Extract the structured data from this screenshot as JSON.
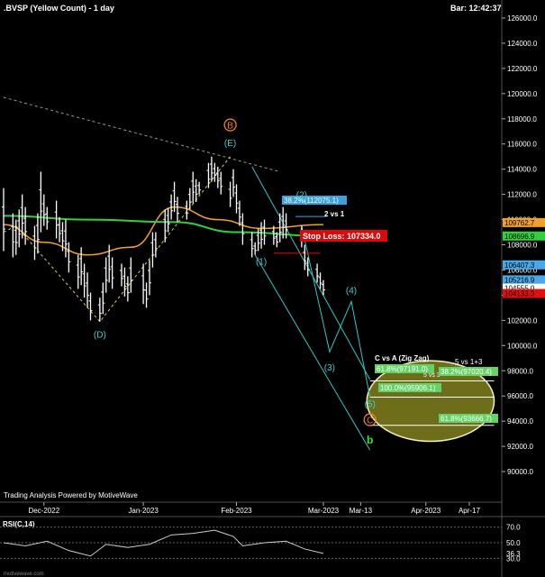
{
  "header": {
    "symbol_title": ".BVSP (Yellow Count) - 1 day",
    "bar_time": "Bar: 12:42:37"
  },
  "footer": {
    "credit": "Trading Analysis Powered by MotiveWave",
    "site": "motivewave.com"
  },
  "colors": {
    "background": "#000000",
    "price_bars": "#ffffff",
    "ma_orange": "#f0a030",
    "ma_green": "#30d040",
    "channel_cyan": "#30c8c8",
    "wave_yellow": "#e0d040",
    "target_fill": "#6e6e1a",
    "stop_red": "#e01010",
    "label_orange": "#f08020",
    "label_green": "#40e040"
  },
  "chart_data": {
    "type": "ohlc",
    "title": ".BVSP (Yellow Count) - 1 day",
    "ylim": [
      88000,
      127000
    ],
    "y_ticks": [
      90000,
      92000,
      94000,
      96000,
      98000,
      100000,
      102000,
      104000,
      106000,
      108000,
      110000,
      112000,
      114000,
      116000,
      118000,
      120000,
      122000,
      124000,
      126000
    ],
    "y_tick_labels": [
      "90000.0",
      "92000.0",
      "94000.0",
      "96000.0",
      "98000.0",
      "100000.0",
      "102000.0",
      "104000.0",
      "106000.0",
      "108000.0",
      "110000.0",
      "112000.0",
      "114000.0",
      "116000.0",
      "118000.0",
      "120000.0",
      "122000.0",
      "124000.0",
      "126000.0"
    ],
    "x_labels": [
      {
        "date": "2022-12-01",
        "label": "Dec-2022"
      },
      {
        "date": "2023-01-02",
        "label": "Jan-2023"
      },
      {
        "date": "2023-02-01",
        "label": "Feb-2023"
      },
      {
        "date": "2023-03-01",
        "label": "Mar-2023"
      },
      {
        "date": "2023-03-13",
        "label": "Mar-13"
      },
      {
        "date": "2023-04-03",
        "label": "Apr-2023"
      },
      {
        "date": "2023-04-17",
        "label": "Apr-17"
      }
    ],
    "x_range": [
      "2022-11-18",
      "2023-04-26"
    ],
    "price_bars": [
      {
        "date": "2022-11-18",
        "high": 112500,
        "low": 107500
      },
      {
        "date": "2022-11-21",
        "high": 110500,
        "low": 107000
      },
      {
        "date": "2022-11-22",
        "high": 110000,
        "low": 107200
      },
      {
        "date": "2022-11-23",
        "high": 110800,
        "low": 107800
      },
      {
        "date": "2022-11-24",
        "high": 112000,
        "low": 108500
      },
      {
        "date": "2022-11-25",
        "high": 111000,
        "low": 108000
      },
      {
        "date": "2022-11-28",
        "high": 109500,
        "low": 106800
      },
      {
        "date": "2022-11-29",
        "high": 110500,
        "low": 107300
      },
      {
        "date": "2022-11-30",
        "high": 113800,
        "low": 109000
      },
      {
        "date": "2022-12-01",
        "high": 112000,
        "low": 109500
      },
      {
        "date": "2022-12-02",
        "high": 111000,
        "low": 109200
      },
      {
        "date": "2022-12-05",
        "high": 111500,
        "low": 108500
      },
      {
        "date": "2022-12-06",
        "high": 110200,
        "low": 108200
      },
      {
        "date": "2022-12-07",
        "high": 109800,
        "low": 107500
      },
      {
        "date": "2022-12-08",
        "high": 110000,
        "low": 107000
      },
      {
        "date": "2022-12-09",
        "high": 108200,
        "low": 105800
      },
      {
        "date": "2022-12-12",
        "high": 107200,
        "low": 104500
      },
      {
        "date": "2022-12-13",
        "high": 107800,
        "low": 104800
      },
      {
        "date": "2022-12-14",
        "high": 106500,
        "low": 103800
      },
      {
        "date": "2022-12-15",
        "high": 105800,
        "low": 103000
      },
      {
        "date": "2022-12-16",
        "high": 104200,
        "low": 102000
      },
      {
        "date": "2022-12-19",
        "high": 103800,
        "low": 101900
      },
      {
        "date": "2022-12-20",
        "high": 105000,
        "low": 102500
      },
      {
        "date": "2022-12-21",
        "high": 107000,
        "low": 104200
      },
      {
        "date": "2022-12-22",
        "high": 108000,
        "low": 105000
      },
      {
        "date": "2022-12-23",
        "high": 107000,
        "low": 104500
      },
      {
        "date": "2022-12-26",
        "high": 106500,
        "low": 104700
      },
      {
        "date": "2022-12-27",
        "high": 106200,
        "low": 103900
      },
      {
        "date": "2022-12-28",
        "high": 105500,
        "low": 103500
      },
      {
        "date": "2022-12-29",
        "high": 107000,
        "low": 104200
      },
      {
        "date": "2023-01-02",
        "high": 106500,
        "low": 103300
      },
      {
        "date": "2023-01-03",
        "high": 105000,
        "low": 103000
      },
      {
        "date": "2023-01-04",
        "high": 106800,
        "low": 104000
      },
      {
        "date": "2023-01-05",
        "high": 109000,
        "low": 106200
      },
      {
        "date": "2023-01-06",
        "high": 109000,
        "low": 107000
      },
      {
        "date": "2023-01-09",
        "high": 110800,
        "low": 108200
      },
      {
        "date": "2023-01-10",
        "high": 110900,
        "low": 109000
      },
      {
        "date": "2023-01-11",
        "high": 112000,
        "low": 110000
      },
      {
        "date": "2023-01-12",
        "high": 113000,
        "low": 110600
      },
      {
        "date": "2023-01-13",
        "high": 111800,
        "low": 109800
      },
      {
        "date": "2023-01-16",
        "high": 111500,
        "low": 110000
      },
      {
        "date": "2023-01-17",
        "high": 112500,
        "low": 110800
      },
      {
        "date": "2023-01-18",
        "high": 113800,
        "low": 111300
      },
      {
        "date": "2023-01-19",
        "high": 113200,
        "low": 111400
      },
      {
        "date": "2023-01-20",
        "high": 113000,
        "low": 112000
      },
      {
        "date": "2023-01-23",
        "high": 114500,
        "low": 112500
      },
      {
        "date": "2023-01-24",
        "high": 115000,
        "low": 113000
      },
      {
        "date": "2023-01-25",
        "high": 114500,
        "low": 113000
      },
      {
        "date": "2023-01-26",
        "high": 114200,
        "low": 112500
      },
      {
        "date": "2023-01-27",
        "high": 113800,
        "low": 112000
      },
      {
        "date": "2023-01-30",
        "high": 113000,
        "low": 111000
      },
      {
        "date": "2023-01-31",
        "high": 114000,
        "low": 111800
      },
      {
        "date": "2023-02-01",
        "high": 112800,
        "low": 110500
      },
      {
        "date": "2023-02-02",
        "high": 111500,
        "low": 109500
      },
      {
        "date": "2023-02-03",
        "high": 110500,
        "low": 108000
      },
      {
        "date": "2023-02-06",
        "high": 109000,
        "low": 107000
      },
      {
        "date": "2023-02-07",
        "high": 108200,
        "low": 107200
      },
      {
        "date": "2023-02-08",
        "high": 109300,
        "low": 107500
      },
      {
        "date": "2023-02-09",
        "high": 109800,
        "low": 107700
      },
      {
        "date": "2023-02-10",
        "high": 110000,
        "low": 108000
      },
      {
        "date": "2023-02-13",
        "high": 109500,
        "low": 108000
      },
      {
        "date": "2023-02-14",
        "high": 109000,
        "low": 107800
      },
      {
        "date": "2023-02-15",
        "high": 110500,
        "low": 108200
      },
      {
        "date": "2023-02-16",
        "high": 111000,
        "low": 108500
      },
      {
        "date": "2023-02-17",
        "high": 110500,
        "low": 108500
      },
      {
        "date": "2023-02-22",
        "high": 109500,
        "low": 107800
      },
      {
        "date": "2023-02-23",
        "high": 108000,
        "low": 106000
      },
      {
        "date": "2023-02-24",
        "high": 107000,
        "low": 105500
      },
      {
        "date": "2023-02-27",
        "high": 106500,
        "low": 105000
      },
      {
        "date": "2023-02-28",
        "high": 105800,
        "low": 104500
      },
      {
        "date": "2023-03-01",
        "high": 105200,
        "low": 104000
      }
    ],
    "moving_averages": [
      {
        "color": "orange",
        "values": [
          [
            " 2022-11-18",
            109600
          ],
          [
            "2022-12-01",
            108200
          ],
          [
            "2022-12-15",
            107200
          ],
          [
            "2022-12-29",
            107800
          ],
          [
            "2023-01-12",
            111000
          ],
          [
            "2023-01-26",
            110000
          ],
          [
            "2023-02-09",
            109300
          ],
          [
            "2023-03-01",
            109600
          ]
        ]
      },
      {
        "color": "green",
        "values": [
          [
            "2022-11-18",
            110300
          ],
          [
            "2022-12-15",
            110000
          ],
          [
            "2023-01-12",
            109800
          ],
          [
            "2023-02-01",
            109000
          ],
          [
            "2023-03-01",
            108700
          ]
        ]
      }
    ],
    "price_tags": [
      {
        "value": 109762.7,
        "label": "109762.7",
        "color": "#f0a030"
      },
      {
        "value": 108696.9,
        "label": "108696.9",
        "color": "#30d040"
      },
      {
        "value": 106407.3,
        "label": "106407.3",
        "color": "#4aa8e8"
      },
      {
        "value": 105216.9,
        "label": "105216.9",
        "color": "#4aa8e8"
      },
      {
        "value": 104555.0,
        "label": "104555.0",
        "color": "#ffffff"
      },
      {
        "value": 104133.3,
        "label": "104133.3",
        "color": "#e01010"
      }
    ],
    "wave_labels": [
      {
        "label": "B",
        "date": "2023-01-30",
        "value": 117300,
        "color": "orange",
        "circled": true
      },
      {
        "label": "(E)",
        "date": "2023-01-30",
        "value": 115900,
        "color": "cyan"
      },
      {
        "label": "(D)",
        "date": "2022-12-19",
        "value": 100700,
        "color": "cyan"
      },
      {
        "label": "(1)",
        "date": "2023-02-09",
        "value": 106500,
        "color": "cyan"
      },
      {
        "label": "(2)",
        "date": "2023-02-22",
        "value": 111800,
        "color": "cyan"
      },
      {
        "label": "(3)",
        "date": "2023-03-03",
        "value": 98100,
        "color": "cyan"
      },
      {
        "label": "(4)",
        "date": "2023-03-10",
        "value": 104200,
        "color": "cyan"
      },
      {
        "label": "(5)",
        "date": "2023-03-16",
        "value": 95200,
        "color": "cyan"
      },
      {
        "label": "C",
        "date": "2023-03-16",
        "value": 93900,
        "color": "orange",
        "circled": true
      },
      {
        "label": "b",
        "date": "2023-03-16",
        "value": 92300,
        "color": "green"
      }
    ],
    "annotations": {
      "fib_272": "38.2%(112075.1)",
      "two_vs_one": "2 vs 1",
      "stop_loss": "Stop Loss: 107334.0",
      "c_vs_a": "C vs A (Zig Zag)",
      "five_vs_13": "5 vs 1+3",
      "five_vs_3": "5 vs 3",
      "fib_618_a": "61.8%(97191.0)",
      "fib_382_b": "38.2%(97020.4)",
      "fib_100": "100.0%(95906.1)",
      "fib_618_c": "61.8%(93666.7)"
    }
  },
  "rsi": {
    "title": "RSI(C,14)",
    "levels": [
      {
        "value": 70,
        "label": "70.0"
      },
      {
        "value": 50,
        "label": "50.0"
      },
      {
        "value": 36.3,
        "label": "36.3"
      },
      {
        "value": 30,
        "label": "30.0"
      }
    ],
    "ylim": [
      20,
      80
    ],
    "series": [
      [
        "2022-11-18",
        50
      ],
      [
        "2022-11-25",
        46
      ],
      [
        "2022-12-02",
        52
      ],
      [
        "2022-12-09",
        40
      ],
      [
        "2022-12-16",
        33
      ],
      [
        "2022-12-21",
        48
      ],
      [
        "2022-12-28",
        44
      ],
      [
        "2023-01-04",
        48
      ],
      [
        "2023-01-11",
        60
      ],
      [
        "2023-01-18",
        62
      ],
      [
        "2023-01-25",
        66
      ],
      [
        "2023-01-31",
        58
      ],
      [
        "2023-02-03",
        46
      ],
      [
        "2023-02-10",
        50
      ],
      [
        "2023-02-17",
        52
      ],
      [
        "2023-02-23",
        42
      ],
      [
        "2023-03-01",
        36.3
      ]
    ]
  }
}
